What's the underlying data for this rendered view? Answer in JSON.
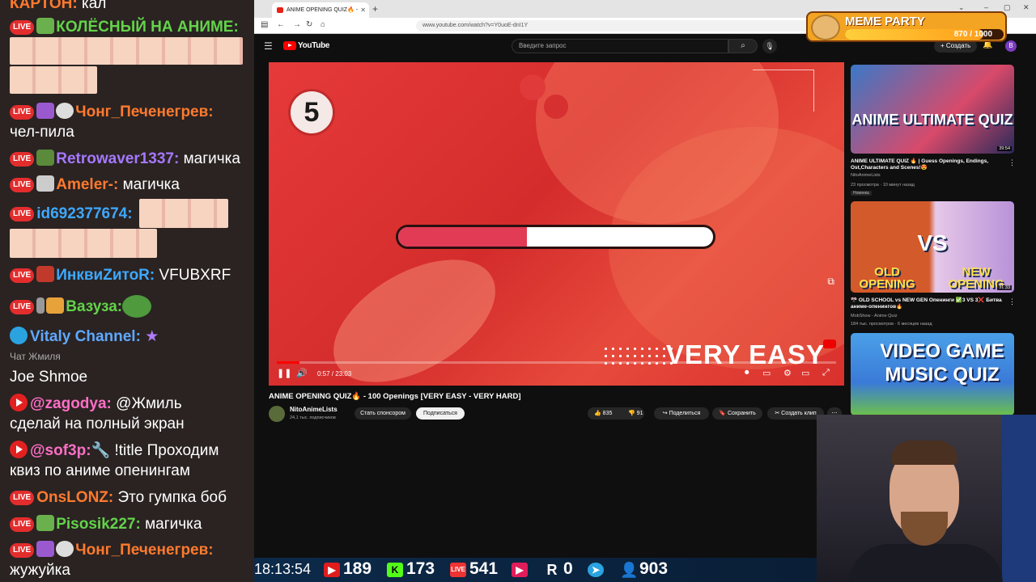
{
  "chat": {
    "messages": [
      {
        "badge": "",
        "nick": "КАРТОН:",
        "nick_color": "orange",
        "text": " кал"
      },
      {
        "badge": "live",
        "nick": "КОЛЁСНЫЙ НА АНИМЕ:",
        "nick_color": "green",
        "text": ""
      },
      {
        "badge": "live",
        "nick": "Чонг_Печенегрев:",
        "nick_color": "orange",
        "text": ""
      },
      {
        "badge": "",
        "nick": "",
        "nick_color": "",
        "text": "чел-пила"
      },
      {
        "badge": "live",
        "nick": "Retrowaver1337:",
        "nick_color": "purple",
        "text": " магичка"
      },
      {
        "badge": "live",
        "nick": "Ameler-:",
        "nick_color": "orange",
        "text": " магичка"
      },
      {
        "badge": "live",
        "nick": "id692377674:",
        "nick_color": "blue",
        "text": ""
      },
      {
        "badge": "live",
        "nick": "ИнквиZитоR:",
        "nick_color": "blue",
        "text": " VFUBXRF"
      },
      {
        "badge": "live",
        "nick": "Вазуза:",
        "nick_color": "green",
        "text": ""
      },
      {
        "badge": "tg",
        "nick": "Vitaly Channel:",
        "nick_color": "teal",
        "text": ""
      },
      {
        "badge": "",
        "nick": "",
        "nick_color": "",
        "text": "Joe Shmoe"
      },
      {
        "badge": "yt",
        "nick": "@zagodya:",
        "nick_color": "pink",
        "text": " @Жмиль"
      },
      {
        "badge": "",
        "nick": "",
        "nick_color": "",
        "text": "сделай на полный экран"
      },
      {
        "badge": "yt",
        "nick": "@sof3p:",
        "nick_color": "pink",
        "text": " !title Проходим"
      },
      {
        "badge": "",
        "nick": "",
        "nick_color": "",
        "text": "квиз по аниме опенингам"
      },
      {
        "badge": "live",
        "nick": "OnsLONZ:",
        "nick_color": "orange",
        "text": " Это гумпка боб"
      },
      {
        "badge": "live",
        "nick": "Pisosik227:",
        "nick_color": "green",
        "text": " магичка"
      },
      {
        "badge": "live",
        "nick": "Чонг_Печенегрев:",
        "nick_color": "orange",
        "text": ""
      },
      {
        "badge": "",
        "nick": "",
        "nick_color": "",
        "text": "жужуйка"
      }
    ],
    "sub_label": "Чат Жмиля",
    "live_label": "LIVE"
  },
  "browser": {
    "tab_title": "ANIME OPENING QUIZ🔥 -",
    "url": "www.youtube.com/watch?v=Y0uoE-dnI1Y"
  },
  "youtube": {
    "logo_text": "YouTube",
    "search_placeholder": "Введите запрос",
    "create_label": "+ Создать",
    "avatar_letter": "В",
    "player": {
      "countdown": "5",
      "progress_fraction": 0.41,
      "difficulty_text": "VERY EASY",
      "timecode": "0:57 / 23:03",
      "seek_fraction": 0.04
    },
    "video_title": "ANIME OPENING QUIZ🔥 - 100 Openings [VERY EASY - VERY HARD]",
    "channel_name": "NitoAnimeLists",
    "channel_subs": "24,1 тыс. подписчиков",
    "sponsor_label": "Стать спонсором",
    "subscribe_label": "Подписаться",
    "likes": "835",
    "dislikes": "91",
    "share_label": "Поделиться",
    "save_label": "Сохранить",
    "clip_label": "Создать клип",
    "recommendations": [
      {
        "thumb_title": "ANIME ULTIMATE QUIZ",
        "duration": "39:54",
        "title": "ANIME ULTIMATE QUIZ 🔥 | Guess Openings, Endings, Ost,Characters and Scenes!😍",
        "channel": "NitoAnimeLists",
        "meta": "23 просмотра · 10 минут назад",
        "badge": "Новинка"
      },
      {
        "thumb_title_left": "OLD OPENING",
        "thumb_vs": "VS",
        "thumb_title_right": "NEW OPENING",
        "duration": "31:33",
        "title": "🎌 OLD SCHOOL vs NEW GEN Опенинги ✅3 VS 3❌ Битва аниме-опенингов🔥",
        "channel": "MobShow - Anime Quiz",
        "meta": "184 тыс. просмотров · 6 месяцев назад"
      },
      {
        "thumb_title": "VIDEO GAME MUSIC QUIZ"
      }
    ]
  },
  "overlay": {
    "meme_title": "MEME PARTY",
    "meme_value": "870 / 1000",
    "meme_fraction": 0.87,
    "time": "18:13:54",
    "youtube_count": "189",
    "kick_count": "173",
    "vk_count": "541",
    "rutube_count": "0",
    "viewers": "903"
  },
  "colors": {
    "accent_red": "#ff0000",
    "player_red": "#d42c2c",
    "progress_pink": "#e23b55",
    "chat_bg": "#2a2322"
  }
}
